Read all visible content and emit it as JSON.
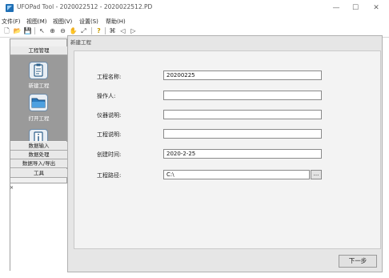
{
  "window": {
    "title": "UFOPad Tool - 2020022512 - 2020022512.PD",
    "app_icon": "ufopad-app-icon",
    "controls": {
      "minimize": "—",
      "maximize": "☐",
      "close": "✕"
    }
  },
  "menu": [
    "文件(F)",
    "视图(M)",
    "视图(V)",
    "设置(S)",
    "帮助(H)"
  ],
  "toolbar": {
    "icons": [
      "new-file-icon",
      "open-folder-icon",
      "save-icon",
      "pointer-icon",
      "zoom-in-icon",
      "zoom-out-icon",
      "pan-icon",
      "zoom-fit-icon",
      "help-icon",
      "export-icon",
      "previous-icon",
      "next-icon"
    ],
    "glyphs": [
      "🗋",
      "📂",
      "💾",
      "↖",
      "⊕",
      "⊖",
      "✋",
      "⤢",
      "?",
      "⌘",
      "◁",
      "▷"
    ]
  },
  "sidebar": {
    "project_header": "工程管理",
    "tools": [
      {
        "label": "新建工程",
        "icon": "clipboard-icon"
      },
      {
        "label": "打开工程",
        "icon": "folder-icon"
      },
      {
        "label": "",
        "icon": "info-icon"
      }
    ],
    "sections": [
      "数据输入",
      "数据处理",
      "数据导入/导出",
      "工具"
    ],
    "pin_glyph": "×"
  },
  "dialog": {
    "title": "新建工程",
    "fields": [
      {
        "label": "工程名称:",
        "value": "20200225"
      },
      {
        "label": "操作人:",
        "value": ""
      },
      {
        "label": "仪器说明:",
        "value": ""
      },
      {
        "label": "工程说明:",
        "value": ""
      },
      {
        "label": "创建时间:",
        "value": "2020-2-25"
      },
      {
        "label": "工程路径:",
        "value": "C:\\"
      }
    ],
    "browse_label": "...",
    "next_label": "下一步"
  }
}
